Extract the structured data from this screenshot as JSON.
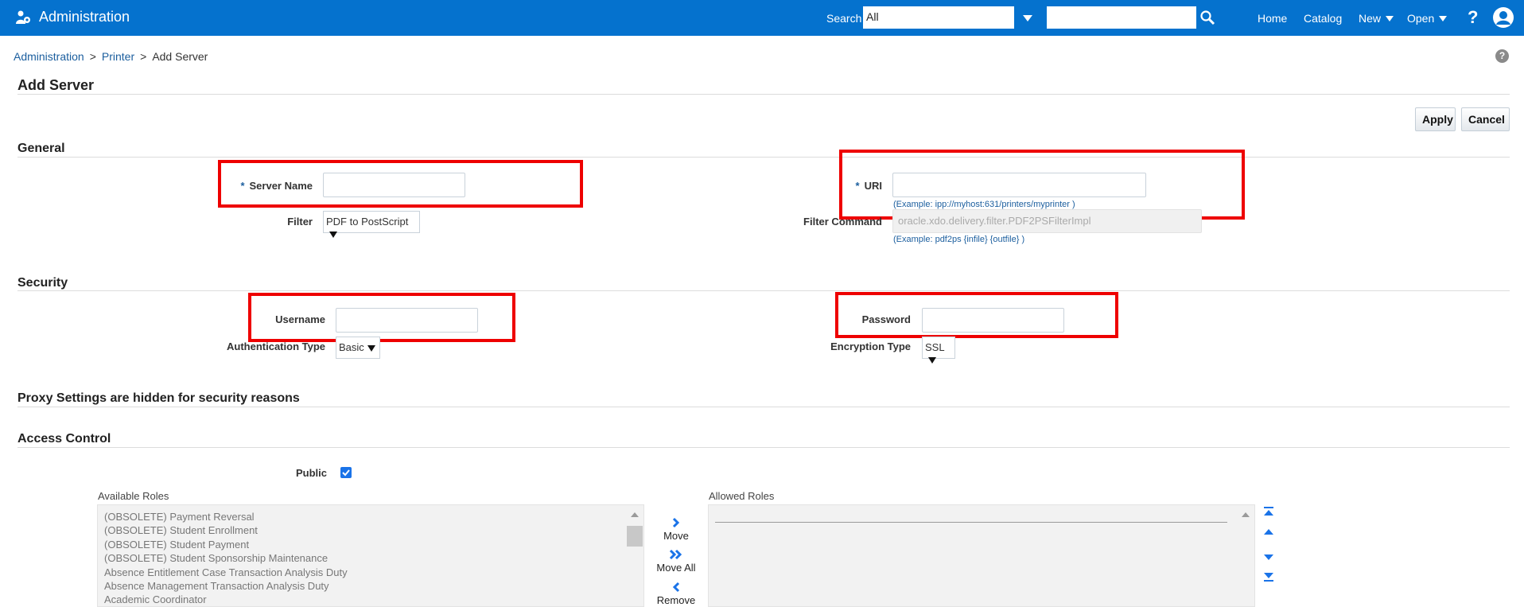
{
  "header": {
    "app_title": "Administration",
    "search_label": "Search",
    "search_scope": "All",
    "search_placeholder": "",
    "nav": {
      "home": "Home",
      "catalog": "Catalog",
      "new": "New",
      "open": "Open",
      "help": "?"
    }
  },
  "breadcrumb": {
    "items": [
      "Administration",
      "Printer",
      "Add Server"
    ],
    "separator": ">"
  },
  "page": {
    "title": "Add Server",
    "apply_label": "Apply",
    "cancel_label": "Cancel"
  },
  "general": {
    "title": "General",
    "required_marker": "*",
    "server_name_label": "Server Name",
    "server_name_value": "",
    "uri_label": "URI",
    "uri_value": "",
    "uri_hint": "(Example: ipp://myhost:631/printers/myprinter )",
    "filter_label": "Filter",
    "filter_value": "PDF to PostScript",
    "filter_command_label": "Filter Command",
    "filter_command_value": "oracle.xdo.delivery.filter.PDF2PSFilterImpl",
    "filter_command_hint": "(Example: pdf2ps {infile} {outfile} )"
  },
  "security": {
    "title": "Security",
    "username_label": "Username",
    "username_value": "",
    "password_label": "Password",
    "password_value": "",
    "auth_type_label": "Authentication Type",
    "auth_type_value": "Basic",
    "encryption_type_label": "Encryption Type",
    "encryption_type_value": "SSL"
  },
  "proxy": {
    "title": "Proxy Settings are hidden for security reasons"
  },
  "access": {
    "title": "Access Control",
    "public_label": "Public",
    "public_checked": true,
    "available_roles_label": "Available Roles",
    "allowed_roles_label": "Allowed Roles",
    "available_roles": [
      "(OBSOLETE) Payment Reversal",
      "(OBSOLETE) Student Enrollment",
      "(OBSOLETE) Student Payment",
      "(OBSOLETE) Student Sponsorship Maintenance",
      "Absence Entitlement Case Transaction Analysis Duty",
      "Absence Management Transaction Analysis Duty",
      "Academic Coordinator"
    ],
    "allowed_roles": [],
    "move_label": "Move",
    "move_all_label": "Move All",
    "remove_label": "Remove"
  },
  "colors": {
    "header_bg": "#0572ce",
    "link": "#1b5e9e",
    "highlight": "#ee0000",
    "checkbox": "#1a73e8"
  },
  "icons": {
    "app": "admin-icon",
    "search": "magnifier-icon",
    "user": "user-avatar-icon",
    "help": "question-circle-icon"
  }
}
